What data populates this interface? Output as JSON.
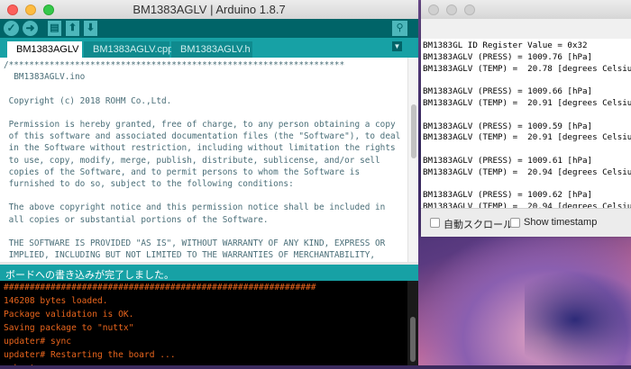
{
  "arduino": {
    "title": "BM1383AGLV | Arduino 1.8.7",
    "toolbar": {
      "verify_icon": "✓",
      "upload_icon": "➜",
      "new_icon": "▤",
      "open_icon": "⬆",
      "save_icon": "⬇",
      "serial_icon": "⚲"
    },
    "tabs": [
      {
        "label": "BM1383AGLV",
        "active": true
      },
      {
        "label": "BM1383AGLV.cpp",
        "active": false
      },
      {
        "label": "BM1383AGLV.h",
        "active": false
      }
    ],
    "tab_menu_icon": "▼",
    "editor_text": "/******************************************************************\n  BM1383AGLV.ino\n\n Copyright (c) 2018 ROHM Co.,Ltd.\n\n Permission is hereby granted, free of charge, to any person obtaining a copy\n of this software and associated documentation files (the \"Software\"), to deal\n in the Software without restriction, including without limitation the rights\n to use, copy, modify, merge, publish, distribute, sublicense, and/or sell\n copies of the Software, and to permit persons to whom the Software is\n furnished to do so, subject to the following conditions:\n\n The above copyright notice and this permission notice shall be included in\n all copies or substantial portions of the Software.\n\n THE SOFTWARE IS PROVIDED \"AS IS\", WITHOUT WARRANTY OF ANY KIND, EXPRESS OR\n IMPLIED, INCLUDING BUT NOT LIMITED TO THE WARRANTIES OF MERCHANTABILITY,\n FITNESS FOR A PARTICULAR PURPOSE AND NONINFRINGEMENT. IN NO EVENT SHALL THE\n AUTHORS OR COPYRIGHT HOLDERS BE LIABLE FOR ANY CLAIM, DAMAGES OR OTHER",
    "status": "ボードへの書き込みが完了しました。",
    "console_text": "############################################################\n146208 bytes loaded.\nPackage validation is OK.\nSaving package to \"nuttx\"\nupdater# sync\nupdater# Restarting the board ...\nreboot"
  },
  "serial": {
    "output_text": "BM1383GL ID Register Value = 0x32\nBM1383AGLV (PRESS) = 1009.76 [hPa]\nBM1383AGLV (TEMP) =  20.78 [degrees Celsius]\n\nBM1383AGLV (PRESS) = 1009.66 [hPa]\nBM1383AGLV (TEMP) =  20.91 [degrees Celsius]\n\nBM1383AGLV (PRESS) = 1009.59 [hPa]\nBM1383AGLV (TEMP) =  20.91 [degrees Celsius]\n\nBM1383AGLV (PRESS) = 1009.61 [hPa]\nBM1383AGLV (TEMP) =  20.94 [degrees Celsius]\n\nBM1383AGLV (PRESS) = 1009.62 [hPa]\nBM1383AGLV (TEMP) =  20.94 [degrees Celsius]",
    "autoscroll_label": "自動スクロール",
    "timestamp_label": "Show timestamp"
  },
  "colors": {
    "toolbar": "#006468",
    "tabbar": "#17a1a5",
    "console_text": "#e9651d"
  }
}
